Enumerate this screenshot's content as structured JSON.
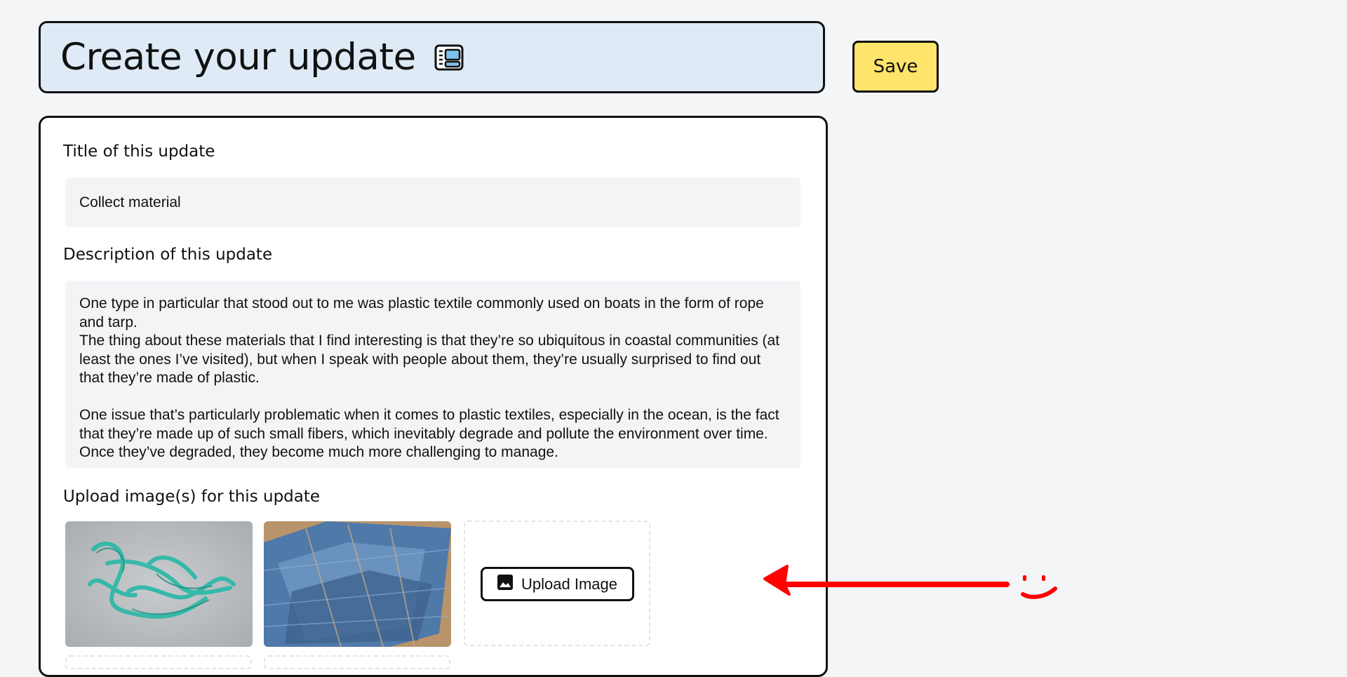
{
  "header": {
    "title": "Create your update",
    "icon": "newspaper-icon"
  },
  "toolbar": {
    "save_label": "Save"
  },
  "form": {
    "title_label": "Title of this update",
    "title_value": "Collect material",
    "description_label": "Description of this update",
    "description_paragraphs": [
      "One type in particular that stood out to me was plastic textile commonly used on boats in the form of rope and tarp.",
      "The thing about these materials that I find interesting is that they’re so ubiquitous in coastal communities (at least the ones I’ve visited), but when I speak with people about them, they’re usually surprised to find out that they’re made of plastic.",
      "One issue that’s particularly problematic when it comes to plastic textiles, especially in the ocean, is the fact that they’re made up of such small fibers, which inevitably degrade and pollute the environment over time. Once they’ve degraded, they become much more challenging to manage."
    ],
    "images_label": "Upload image(s) for this update",
    "images": [
      {
        "subject": "green rope on sand"
      },
      {
        "subject": "blue tarp fabric"
      }
    ],
    "upload_button_label": "Upload Image",
    "upload_icon": "image-icon"
  },
  "annotation": {
    "arrow": "red-arrow-icon",
    "face": "smiley-icon",
    "color": "#ff0000"
  },
  "colors": {
    "header_bg": "#deebf7",
    "save_bg": "#ffe46b",
    "input_bg": "#f3f4f6",
    "page_bg": "#f4f5f7"
  }
}
